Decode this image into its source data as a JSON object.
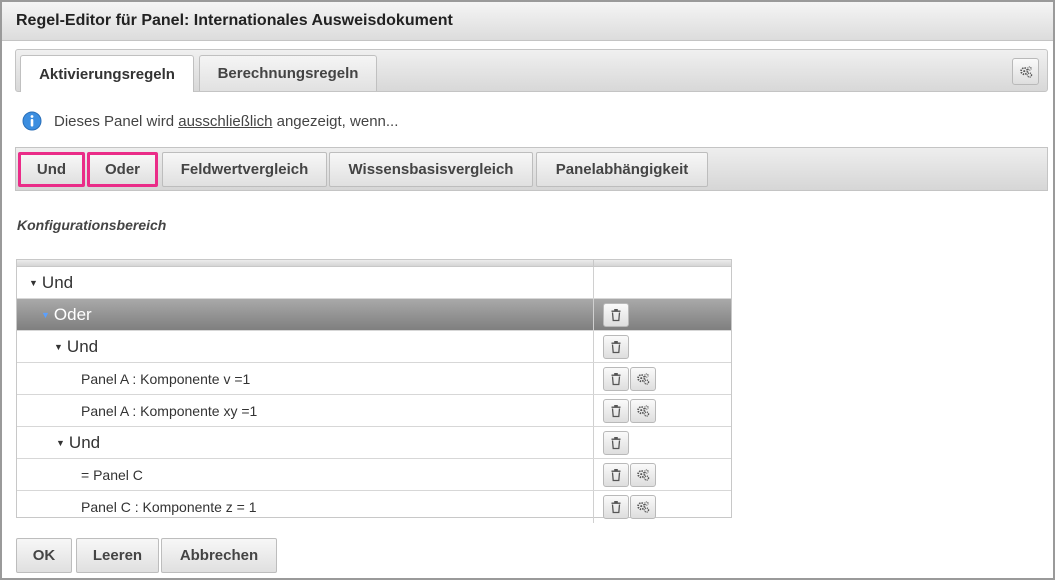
{
  "window": {
    "title": "Regel-Editor für Panel: Internationales Ausweisdokument"
  },
  "tabs": [
    {
      "label": "Aktivierungsregeln",
      "active": true
    },
    {
      "label": "Berechnungsregeln",
      "active": false
    }
  ],
  "info": {
    "before": "Dieses Panel wird",
    "link": "ausschließlich",
    "after": "angezeigt, wenn..."
  },
  "operators": [
    "Und",
    "Oder",
    "Feldwertvergleich",
    "Wissensbasisvergleich",
    "Panelabhängigkeit"
  ],
  "section_label": "Konfigurationsbereich",
  "tree": [
    {
      "label": "Und",
      "caret": "▼"
    },
    {
      "label": "Oder",
      "caret": "▼"
    },
    {
      "label": "Und",
      "caret": "▼"
    },
    {
      "label": "Panel A : Komponente v =1"
    },
    {
      "label": "Panel A : Komponente xy =1"
    },
    {
      "label": "Und",
      "caret": "▼"
    },
    {
      "label": "= Panel C"
    },
    {
      "label": "Panel C : Komponente z = 1"
    }
  ],
  "footer": {
    "ok": "OK",
    "clear": "Leeren",
    "cancel": "Abbrechen"
  },
  "colors": {
    "highlight": "#ea2c88",
    "selected_row": "#8a8a8a",
    "info_icon": "#3c8ee0"
  },
  "icons": {
    "gear": "gears-icon",
    "trash": "trash-icon",
    "info": "info-icon"
  }
}
